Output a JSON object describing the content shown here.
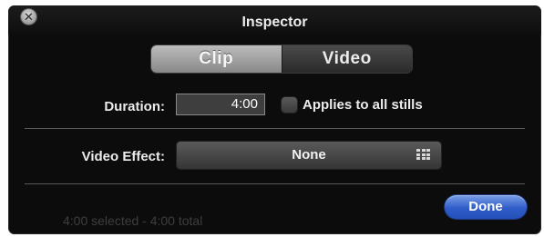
{
  "window": {
    "title": "Inspector",
    "close_glyph": "✕"
  },
  "tabs": [
    {
      "label": "Clip",
      "selected": true
    },
    {
      "label": "Video",
      "selected": false
    }
  ],
  "duration": {
    "label": "Duration:",
    "value": "4:00"
  },
  "applies_all": {
    "label": "Applies to all stills",
    "checked": false
  },
  "video_effect": {
    "label": "Video Effect:",
    "value": "None",
    "icon": "grid-icon"
  },
  "status": {
    "text": "4:00 selected - 4:00 total"
  },
  "done_button": {
    "label": "Done"
  },
  "colors": {
    "panel_bg": "#0c0c0c",
    "done_blue": "#2f5cc9",
    "text": "#ececec"
  }
}
